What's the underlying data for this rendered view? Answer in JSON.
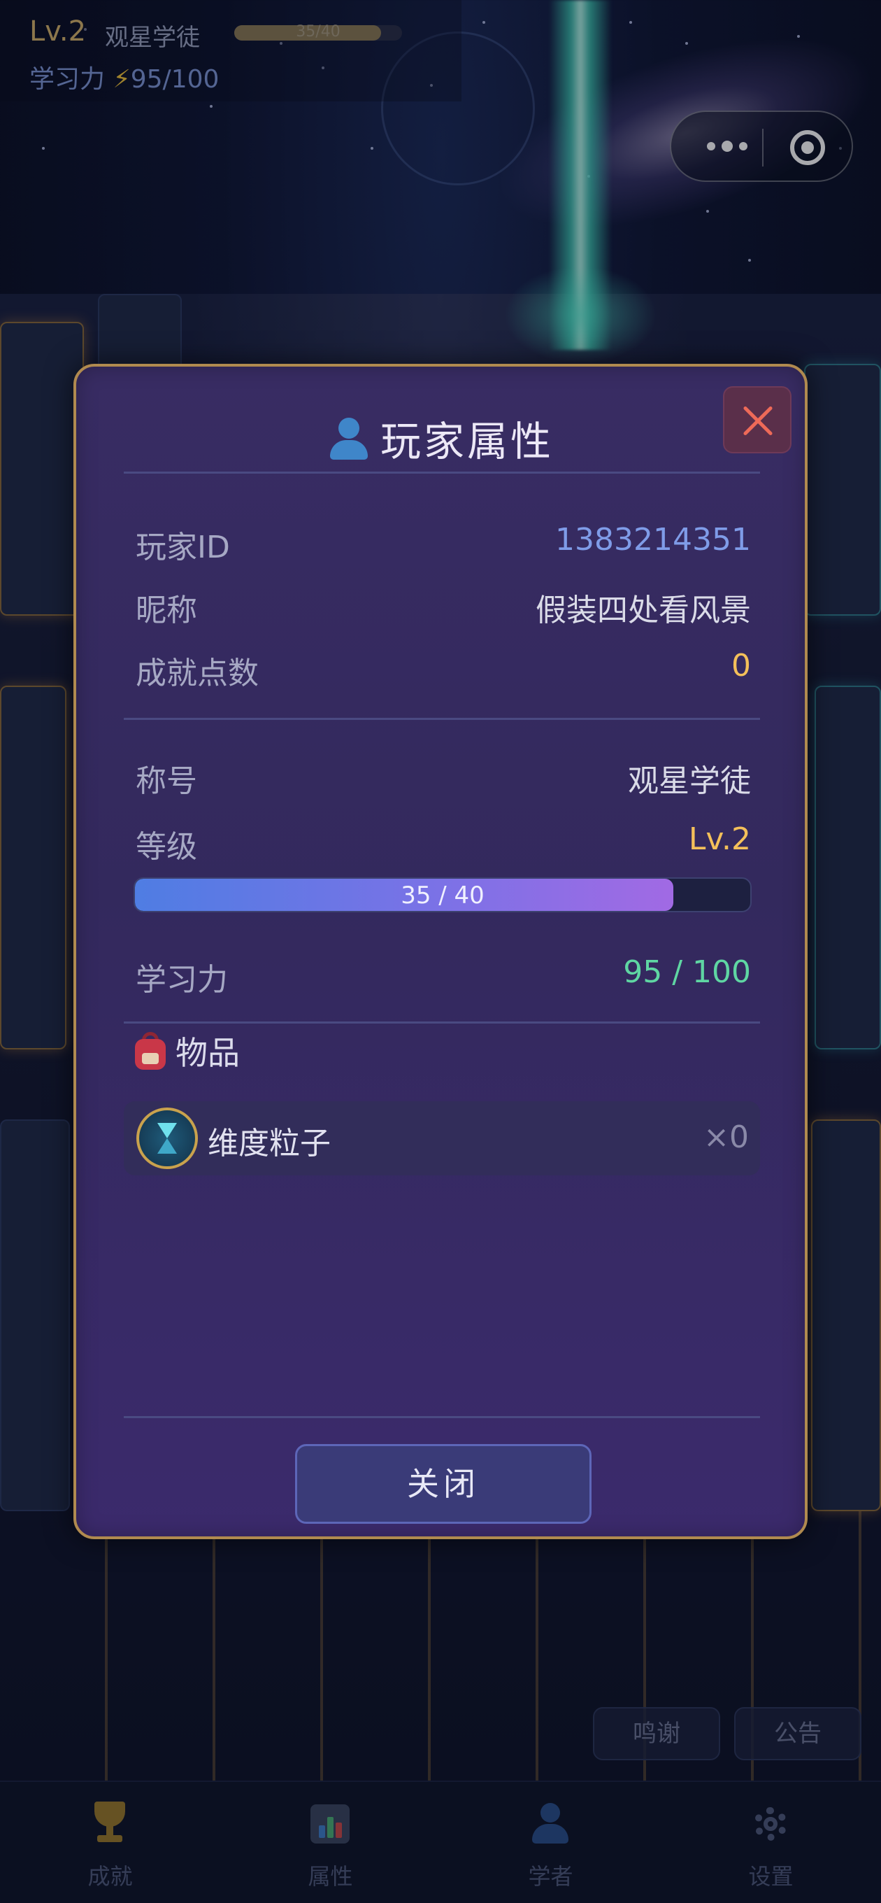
{
  "hud": {
    "level": "Lv.2",
    "rank": "观星学徒",
    "xp_text": "35/40",
    "xp_progress": 0.875,
    "power_label": "学习力",
    "power_value": "95/100"
  },
  "modal": {
    "title": "玩家属性",
    "basic": [
      {
        "key": "玩家ID",
        "value": "1383214351"
      },
      {
        "key": "昵称",
        "value": "假装四处看风景"
      },
      {
        "key": "成就点数",
        "value": "0"
      }
    ],
    "rank": {
      "key": "称号",
      "value": "观星学徒"
    },
    "level": {
      "key": "等级",
      "value": "Lv.2"
    },
    "xp": {
      "text": "35 / 40",
      "current": 35,
      "max": 40
    },
    "power": {
      "key": "学习力",
      "value": "95 / 100"
    },
    "items_title": "物品",
    "items": [
      {
        "name": "维度粒子",
        "count": "×0",
        "icon": "hourglass-icon"
      }
    ],
    "close_label": "关闭"
  },
  "side_buttons": {
    "credits": "鸣谢",
    "notice": "公告"
  },
  "tabs": [
    {
      "label": "成就",
      "icon": "trophy-icon"
    },
    {
      "label": "属性",
      "icon": "bar-chart-icon"
    },
    {
      "label": "学者",
      "icon": "person-icon"
    },
    {
      "label": "设置",
      "icon": "gear-icon"
    }
  ],
  "colors": {
    "id_value": "#7f9ce8",
    "gold_value": "#f4c05a",
    "power_value": "#5fd6a3",
    "modal_border": "#b08a4f",
    "close_x": "#ee6a58"
  }
}
